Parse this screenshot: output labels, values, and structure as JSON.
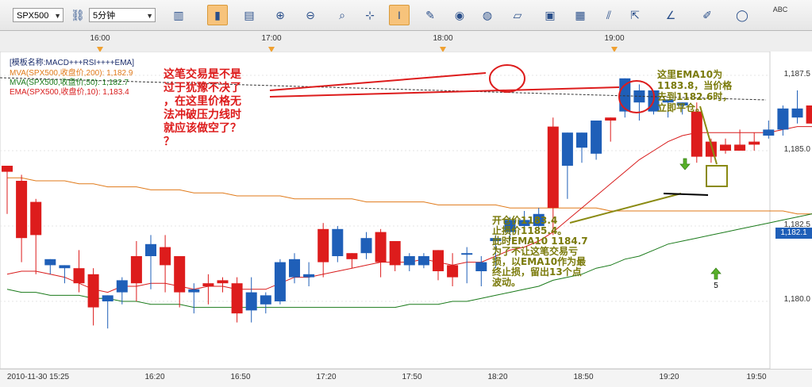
{
  "toolbar": {
    "symbol": "SPX500",
    "period": "5分钟",
    "icons": [
      "link-icon",
      "bar-chart-icon",
      "candlestick-icon",
      "heikin-icon",
      "zoom-in-icon",
      "zoom-out-icon",
      "zoom-fit-icon",
      "crosshair-icon",
      "draw-icon",
      "eye-icon",
      "globe-icon",
      "ruler-icon",
      "picture-icon",
      "chart-window-icon",
      "lines-icon",
      "export-icon",
      "trendlines-icon",
      "pen-icon",
      "ellipse-icon",
      "text-icon"
    ],
    "text_tool": "ABC"
  },
  "time_axis_top": [
    "16:00",
    "17:00",
    "18:00",
    "19:00"
  ],
  "template_label": "[模板名称:MACD+++RSI++++EMA]",
  "indicators": [
    {
      "text": "MVA(SPX500,收盘价,200): 1,182.9",
      "color": "#e07a1a"
    },
    {
      "text": "MVA(SPX500,收盘价,50): 1,182.7",
      "color": "#1a7a1a"
    },
    {
      "text": "EMA(SPX500,收盘价,10): 1,183.4",
      "color": "#d81b1b"
    }
  ],
  "annotations": {
    "red_note": [
      "这笔交易是不是",
      "过于犹豫不决了",
      "，在这里价格无",
      "法冲破压力线时",
      "就应该做空了？",
      "？"
    ],
    "olive_right": [
      "这里EMA10为",
      "1183.8，当价格",
      "去到1182.6时，",
      "立即平仓。"
    ],
    "olive_mid": [
      "开仓价1183.4",
      "止损价1185.4。",
      "此时EMA10 1184.7",
      "为了不让这笔交易亏",
      "损，以EMA10作为最",
      "终止损，留出13个点",
      "波动。"
    ],
    "arrow_count": "5"
  },
  "price_axis": [
    "1,187.5",
    "1,185.0",
    "1,182.5",
    "1,180.0"
  ],
  "last_price": "1,182.1",
  "bottom_axis": [
    "2010-11-30 15:25",
    "16:20",
    "16:50",
    "17:20",
    "17:50",
    "18:20",
    "18:50",
    "19:20",
    "19:50"
  ],
  "colors": {
    "up": "#1f5fb8",
    "down": "#dd1c1c",
    "ema10": "#d81b1b",
    "mva50": "#1a7a1a",
    "mva200": "#e07a1a"
  },
  "chart_data": {
    "type": "candlestick",
    "ylim": [
      1178.0,
      1188.0
    ],
    "candles": [
      [
        1184.5,
        1183.8,
        1184.3,
        1182.9
      ],
      [
        1184.0,
        1184.2,
        1182.1,
        1181.3
      ],
      [
        1183.3,
        1183.4,
        1182.2,
        1180.9
      ],
      [
        1181.2,
        1181.0,
        1181.4,
        1180.9
      ],
      [
        1181.1,
        1181.0,
        1181.2,
        1180.6
      ],
      [
        1181.1,
        1181.7,
        1180.6,
        1180.3
      ],
      [
        1180.9,
        1181.1,
        1179.8,
        1179.2
      ],
      [
        1180.0,
        1179.7,
        1180.2,
        1179.1
      ],
      [
        1180.3,
        1180.8,
        1180.7,
        1179.9
      ],
      [
        1181.5,
        1182.0,
        1180.6,
        1180.0
      ],
      [
        1181.5,
        1182.2,
        1181.9,
        1180.4
      ],
      [
        1181.8,
        1182.2,
        1181.2,
        1180.3
      ],
      [
        1181.5,
        1181.5,
        1180.3,
        1179.8
      ],
      [
        1180.3,
        1180.6,
        1180.4,
        1179.6
      ],
      [
        1180.6,
        1180.9,
        1180.5,
        1179.9
      ],
      [
        1180.7,
        1180.8,
        1180.6,
        1180.3
      ],
      [
        1180.6,
        1180.8,
        1179.6,
        1179.3
      ],
      [
        1179.7,
        1180.8,
        1180.3,
        1179.3
      ],
      [
        1179.9,
        1180.3,
        1180.2,
        1179.6
      ],
      [
        1180.0,
        1181.4,
        1181.3,
        1179.9
      ],
      [
        1180.8,
        1181.6,
        1181.4,
        1180.6
      ],
      [
        1180.8,
        1181.3,
        1180.9,
        1180.5
      ],
      [
        1182.4,
        1182.6,
        1181.3,
        1180.8
      ],
      [
        1181.5,
        1182.5,
        1182.4,
        1181.3
      ],
      [
        1181.6,
        1181.6,
        1181.4,
        1181.1
      ],
      [
        1181.6,
        1182.3,
        1182.1,
        1181.4
      ],
      [
        1182.3,
        1182.4,
        1181.3,
        1180.8
      ],
      [
        1182.0,
        1182.0,
        1181.2,
        1181.0
      ],
      [
        1181.2,
        1181.6,
        1181.5,
        1181.0
      ],
      [
        1181.2,
        1181.6,
        1181.5,
        1181.1
      ],
      [
        1181.7,
        1181.7,
        1181.0,
        1180.7
      ],
      [
        1181.2,
        1181.6,
        1180.8,
        1180.5
      ],
      [
        1181.6,
        1181.8,
        1181.6,
        1180.6
      ],
      [
        1181.0,
        1181.5,
        1181.3,
        1180.5
      ],
      [
        1182.0,
        1182.2,
        1182.1,
        1181.1
      ],
      [
        1182.3,
        1182.8,
        1182.7,
        1182.0
      ],
      [
        1182.5,
        1183.0,
        1182.7,
        1182.3
      ],
      [
        1182.5,
        1183.1,
        1182.9,
        1182.4
      ],
      [
        1185.8,
        1186.1,
        1183.1,
        1182.2
      ],
      [
        1184.5,
        1184.8,
        1185.6,
        1183.4
      ],
      [
        1185.1,
        1185.0,
        1185.6,
        1184.6
      ],
      [
        1184.9,
        1185.2,
        1186.0,
        1184.7
      ],
      [
        1186.1,
        1185.5,
        1186.0,
        1185.3
      ],
      [
        1186.3,
        1186.6,
        1187.4,
        1186.1
      ],
      [
        1186.6,
        1187.2,
        1187.0,
        1186.0
      ],
      [
        1186.3,
        1186.9,
        1187.0,
        1186.2
      ],
      [
        1186.6,
        1186.6,
        1186.7,
        1186.1
      ],
      [
        1186.5,
        1186.6,
        1186.6,
        1186.2
      ],
      [
        1186.3,
        1186.6,
        1184.8,
        1184.6
      ],
      [
        1185.3,
        1185.4,
        1184.8,
        1184.6
      ],
      [
        1185.2,
        1185.4,
        1185.0,
        1184.9
      ],
      [
        1185.2,
        1185.7,
        1185.0,
        1185.0
      ],
      [
        1185.3,
        1185.6,
        1185.2,
        1185.0
      ],
      [
        1185.5,
        1186.0,
        1185.7,
        1185.4
      ],
      [
        1185.7,
        1186.5,
        1186.4,
        1185.5
      ],
      [
        1186.1,
        1187.0,
        1186.4,
        1185.9
      ],
      [
        1186.5,
        1186.5,
        1185.9,
        1185.9
      ],
      [
        1186.0,
        1186.0,
        1185.0,
        1184.5
      ],
      [
        1185.0,
        1185.0,
        1184.1,
        1183.3
      ],
      [
        1184.0,
        1184.5,
        1183.7,
        1183.4
      ],
      [
        1183.6,
        1183.7,
        1182.0,
        1181.6
      ],
      [
        1181.9,
        1182.0,
        1181.6,
        1181.0
      ],
      [
        1181.4,
        1182.3,
        1181.7,
        1181.0
      ],
      [
        1181.6,
        1182.2,
        1182.0,
        1181.3
      ]
    ],
    "ema10": [
      1180.9,
      1181.0,
      1181.0,
      1180.9,
      1180.8,
      1180.6,
      1180.4,
      1180.3,
      1180.5,
      1180.5,
      1180.6,
      1180.6,
      1180.5,
      1180.4,
      1180.5,
      1180.5,
      1180.4,
      1180.4,
      1180.4,
      1180.6,
      1180.8,
      1180.8,
      1180.9,
      1181.0,
      1181.1,
      1181.2,
      1181.3,
      1181.3,
      1181.3,
      1181.4,
      1181.3,
      1181.2,
      1181.3,
      1181.3,
      1181.5,
      1181.7,
      1181.8,
      1182.0,
      1182.3,
      1182.7,
      1183.1,
      1183.5,
      1183.9,
      1184.3,
      1184.7,
      1185.0,
      1185.3,
      1185.5,
      1185.6,
      1185.6,
      1185.6,
      1185.6,
      1185.6,
      1185.6,
      1185.7,
      1185.8,
      1185.8,
      1185.7,
      1185.4,
      1185.1,
      1184.6,
      1184.2,
      1183.8,
      1183.5
    ],
    "mva50": [
      1180.4,
      1180.3,
      1180.3,
      1180.2,
      1180.2,
      1180.2,
      1180.1,
      1180.1,
      1180.0,
      1180.0,
      1179.9,
      1179.9,
      1179.9,
      1179.8,
      1179.8,
      1179.8,
      1179.8,
      1179.8,
      1179.8,
      1179.8,
      1179.8,
      1179.8,
      1179.8,
      1179.8,
      1179.8,
      1179.8,
      1179.8,
      1179.8,
      1179.9,
      1179.9,
      1179.9,
      1180.0,
      1180.0,
      1180.1,
      1180.2,
      1180.3,
      1180.4,
      1180.5,
      1180.7,
      1180.8,
      1180.9,
      1181.1,
      1181.2,
      1181.4,
      1181.5,
      1181.7,
      1181.9,
      1182.0,
      1182.1,
      1182.2,
      1182.3,
      1182.4,
      1182.5,
      1182.6,
      1182.7,
      1182.8,
      1182.9,
      1182.9,
      1183.0,
      1183.0,
      1183.0,
      1183.0,
      1183.0,
      1183.0
    ],
    "mva200": [
      1184.1,
      1184.1,
      1184.0,
      1184.0,
      1184.0,
      1183.9,
      1183.9,
      1183.8,
      1183.8,
      1183.8,
      1183.7,
      1183.7,
      1183.7,
      1183.6,
      1183.6,
      1183.6,
      1183.5,
      1183.5,
      1183.5,
      1183.5,
      1183.4,
      1183.4,
      1183.4,
      1183.4,
      1183.4,
      1183.3,
      1183.3,
      1183.3,
      1183.3,
      1183.3,
      1183.2,
      1183.2,
      1183.2,
      1183.2,
      1183.2,
      1183.1,
      1183.1,
      1183.1,
      1183.1,
      1183.1,
      1183.1,
      1183.1,
      1183.0,
      1183.0,
      1183.0,
      1183.0,
      1183.0,
      1183.0,
      1183.0,
      1183.0,
      1183.0,
      1183.0,
      1183.0,
      1183.0,
      1183.0,
      1182.9,
      1182.9,
      1182.9,
      1182.9,
      1182.9,
      1182.9,
      1182.9,
      1182.9,
      1182.9
    ]
  }
}
